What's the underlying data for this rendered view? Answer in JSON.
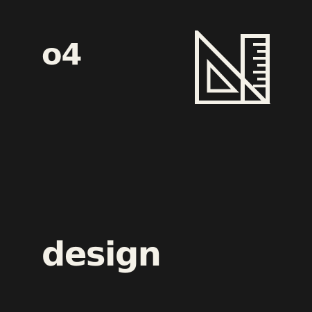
{
  "card": {
    "number": "o4",
    "label": "design",
    "icon": "triangle-ruler-icon",
    "colors": {
      "background": "#191919",
      "foreground": "#f4f1e8"
    }
  }
}
